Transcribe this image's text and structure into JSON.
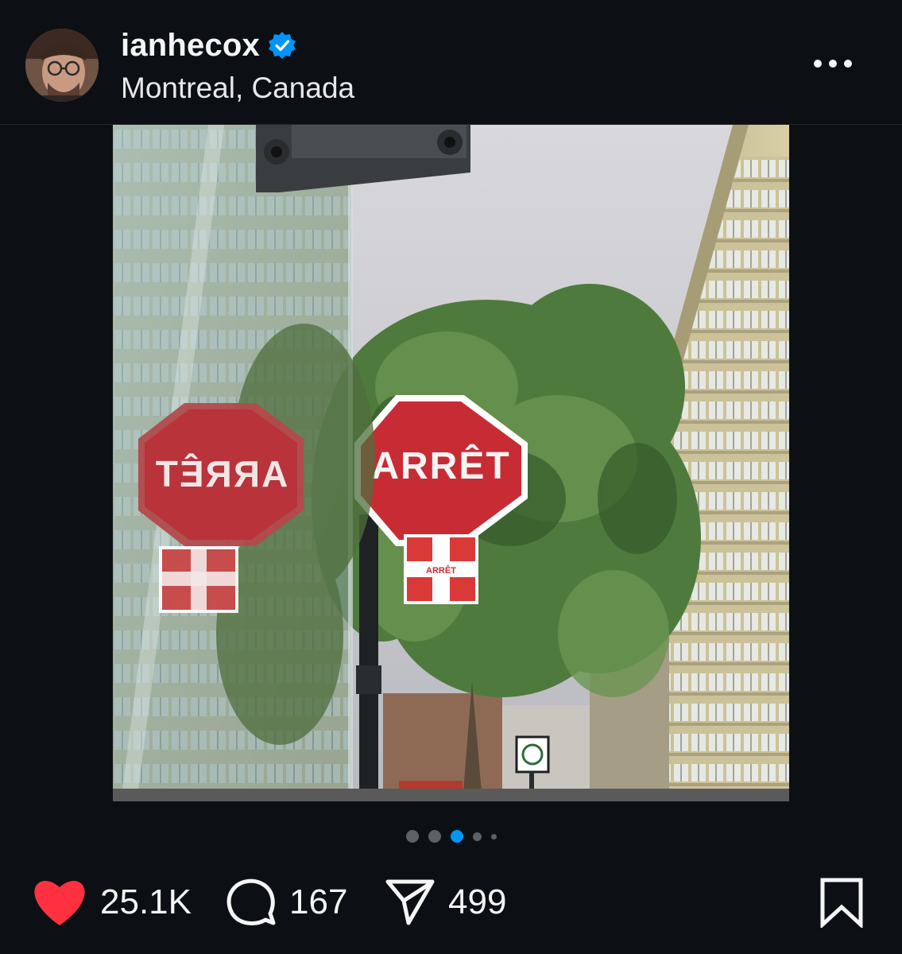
{
  "post": {
    "username": "ianhecox",
    "location": "Montreal, Canada",
    "verified": true,
    "media": {
      "sign_text": "ARRÊT",
      "mirrored_sign_text": "ARRÊT",
      "sticker_text": "ARRÊT",
      "current_slide": 3,
      "slide_count": 5
    },
    "stats": {
      "likes": "25.1K",
      "comments": "167",
      "shares": "499"
    }
  },
  "icons": {
    "verified": "verified-badge-icon",
    "more": "more-options-icon",
    "mute": "muted-speaker-icon",
    "like": "heart-icon",
    "comment": "comment-bubble-icon",
    "share": "paper-plane-icon",
    "save": "bookmark-icon"
  },
  "colors": {
    "background": "#0c1014",
    "accent": "#0095f6",
    "like": "#ff3040",
    "text": "#f5f5f5"
  }
}
